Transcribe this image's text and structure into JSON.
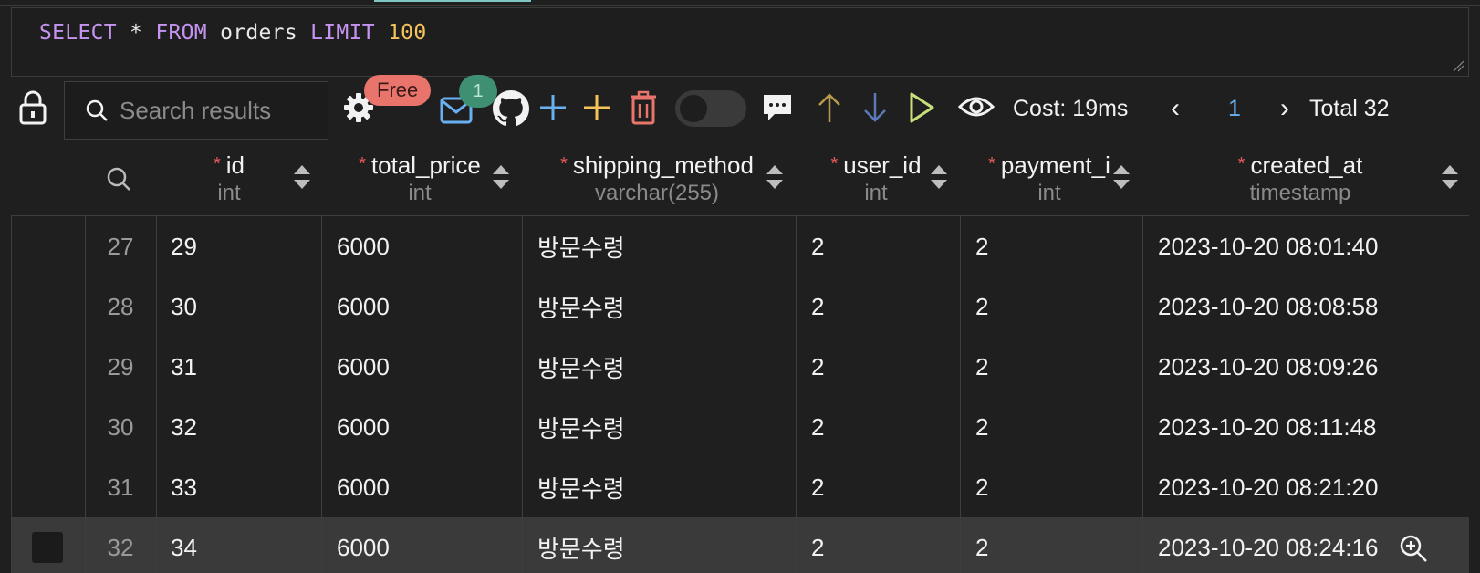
{
  "editor": {
    "query_tokens": [
      {
        "text": "SELECT",
        "kind": "kw"
      },
      {
        "text": " * ",
        "kind": "plain"
      },
      {
        "text": "FROM",
        "kind": "kw"
      },
      {
        "text": " orders ",
        "kind": "plain"
      },
      {
        "text": "LIMIT",
        "kind": "kw"
      },
      {
        "text": " ",
        "kind": "plain"
      },
      {
        "text": "100",
        "kind": "num"
      }
    ]
  },
  "toolbar": {
    "search_placeholder": "Search results",
    "free_badge": "Free",
    "mail_count": "1",
    "cost_label": "Cost: 19ms",
    "page_prev": "‹",
    "current_page": "1",
    "page_next": "›",
    "total_label": "Total 32",
    "toggle_on": false,
    "colors": {
      "add": "#6ab0f0",
      "add_alt": "#f5c25b",
      "delete": "#e8746c",
      "run": "#c9e07a",
      "sort_up": "#b89a4a",
      "sort_down": "#5a7ab8"
    }
  },
  "table": {
    "columns": [
      {
        "name": "id",
        "type": "int",
        "required": true
      },
      {
        "name": "total_price",
        "type": "int",
        "required": true
      },
      {
        "name": "shipping_method",
        "type": "varchar(255)",
        "required": true
      },
      {
        "name": "user_id",
        "type": "int",
        "required": true
      },
      {
        "name": "payment_i",
        "type": "int",
        "required": true
      },
      {
        "name": "created_at",
        "type": "timestamp",
        "required": true
      }
    ],
    "rows": [
      {
        "num": "27",
        "cells": [
          "29",
          "6000",
          "방문수령",
          "2",
          "2",
          "2023-10-20 08:01:40"
        ]
      },
      {
        "num": "28",
        "cells": [
          "30",
          "6000",
          "방문수령",
          "2",
          "2",
          "2023-10-20 08:08:58"
        ]
      },
      {
        "num": "29",
        "cells": [
          "31",
          "6000",
          "방문수령",
          "2",
          "2",
          "2023-10-20 08:09:26"
        ]
      },
      {
        "num": "30",
        "cells": [
          "32",
          "6000",
          "방문수령",
          "2",
          "2",
          "2023-10-20 08:11:48"
        ]
      },
      {
        "num": "31",
        "cells": [
          "33",
          "6000",
          "방문수령",
          "2",
          "2",
          "2023-10-20 08:21:20"
        ]
      },
      {
        "num": "32",
        "cells": [
          "34",
          "6000",
          "방문수령",
          "2",
          "2",
          "2023-10-20 08:24:16"
        ],
        "selected": true
      }
    ]
  }
}
